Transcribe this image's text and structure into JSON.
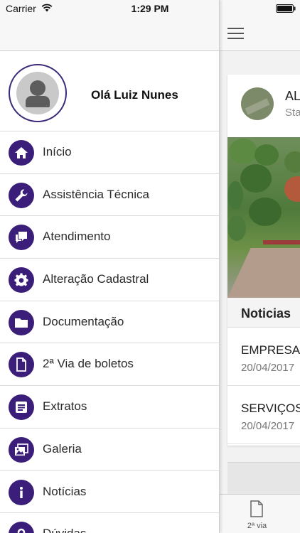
{
  "status_bar": {
    "carrier": "Carrier",
    "time": "1:29 PM"
  },
  "drawer": {
    "greeting": "Olá Luiz Nunes",
    "menu": [
      {
        "label": "Início",
        "icon": "home-icon"
      },
      {
        "label": "Assistência Técnica",
        "icon": "wrench-icon"
      },
      {
        "label": "Atendimento",
        "icon": "chat-icon"
      },
      {
        "label": "Alteração Cadastral",
        "icon": "gear-icon"
      },
      {
        "label": "Documentação",
        "icon": "folder-icon"
      },
      {
        "label": "2ª Via de boletos",
        "icon": "document-icon"
      },
      {
        "label": "Extratos",
        "icon": "list-icon"
      },
      {
        "label": "Galeria",
        "icon": "gallery-icon"
      },
      {
        "label": "Notícias",
        "icon": "info-icon"
      },
      {
        "label": "Dúvidas",
        "icon": "question-icon"
      }
    ]
  },
  "main": {
    "card": {
      "title": "AL",
      "subtitle": "Sta"
    },
    "section_title": "Noticias",
    "news": [
      {
        "title": "EMPRESA",
        "date": "20/04/2017"
      },
      {
        "title": "SERVIÇOS",
        "date": "20/04/2017"
      }
    ],
    "tab_label": "2ª via"
  },
  "colors": {
    "accent": "#3a1e79",
    "ring": "#3d2a7a",
    "navbar": "#f7f7f7"
  }
}
